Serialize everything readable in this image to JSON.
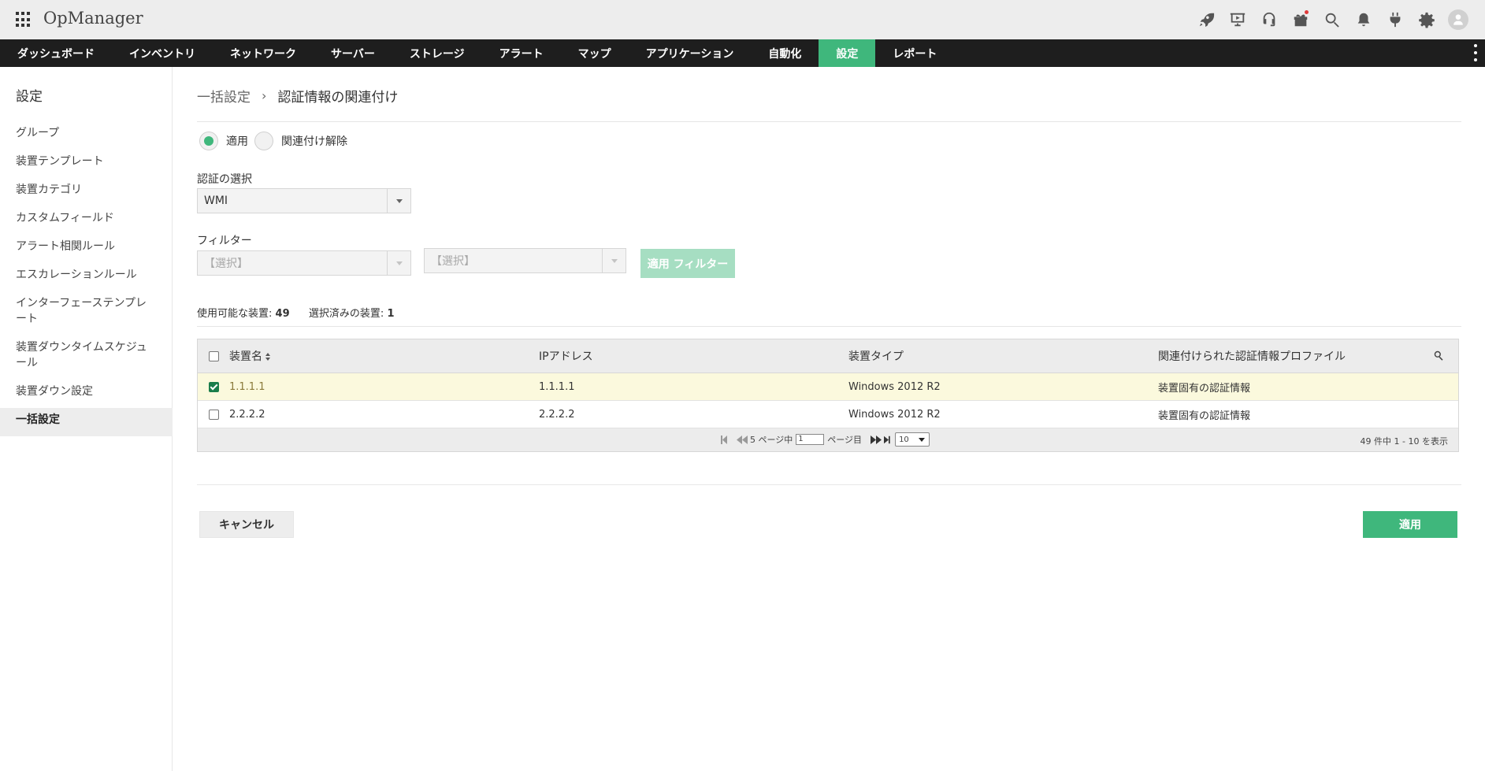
{
  "app": {
    "title": "OpManager"
  },
  "top_icons": [
    {
      "name": "rocket-icon"
    },
    {
      "name": "presentation-icon"
    },
    {
      "name": "headset-icon"
    },
    {
      "name": "gift-icon"
    },
    {
      "name": "search-icon"
    },
    {
      "name": "bell-icon"
    },
    {
      "name": "plug-icon"
    },
    {
      "name": "gear-icon"
    },
    {
      "name": "user-avatar-icon"
    }
  ],
  "nav": {
    "items": [
      {
        "label": "ダッシュボード"
      },
      {
        "label": "インベントリ"
      },
      {
        "label": "ネットワーク"
      },
      {
        "label": "サーバー"
      },
      {
        "label": "ストレージ"
      },
      {
        "label": "アラート"
      },
      {
        "label": "マップ"
      },
      {
        "label": "アプリケーション"
      },
      {
        "label": "自動化"
      },
      {
        "label": "設定"
      },
      {
        "label": "レポート"
      }
    ],
    "active": "設定",
    "accent_color": "#3fb77c"
  },
  "sidebar": {
    "title": "設定",
    "items": [
      {
        "label": "グループ"
      },
      {
        "label": "装置テンプレート"
      },
      {
        "label": "装置カテゴリ"
      },
      {
        "label": "カスタムフィールド"
      },
      {
        "label": "アラート相関ルール"
      },
      {
        "label": "エスカレーションルール"
      },
      {
        "label": "インターフェーステンプレート"
      },
      {
        "label": "装置ダウンタイムスケジュール"
      },
      {
        "label": "装置ダウン設定"
      },
      {
        "label": "一括設定"
      }
    ],
    "active": "一括設定"
  },
  "breadcrumb": {
    "parent": "一括設定",
    "separator": "›",
    "current": "認証情報の関連付け"
  },
  "mode": {
    "options": [
      {
        "label": "適用",
        "checked": true
      },
      {
        "label": "関連付け解除",
        "checked": false
      }
    ]
  },
  "credential": {
    "label": "認証の選択",
    "value": "WMI"
  },
  "filter": {
    "label": "フィルター",
    "primary_value": "【選択】",
    "secondary_value": "【選択】",
    "apply_label": "適用 フィルター"
  },
  "counts": {
    "available_label": "使用可能な装置:",
    "available_value": "49",
    "selected_label": "選択済みの装置:",
    "selected_value": "1"
  },
  "table": {
    "columns": [
      "装置名",
      "IPアドレス",
      "装置タイプ",
      "関連付けられた認証情報プロファイル"
    ],
    "rows": [
      {
        "name": "1.1.1.1",
        "ip": "1.1.1.1",
        "type": "Windows 2012 R2",
        "profile": "装置固有の認証情報",
        "checked": true
      },
      {
        "name": "2.2.2.2",
        "ip": "2.2.2.2",
        "type": "Windows 2012 R2",
        "profile": "装置固有の認証情報",
        "checked": false
      }
    ]
  },
  "pager": {
    "pages_prefix": "5 ページ中",
    "current_page": "1",
    "pages_suffix": "ページ目",
    "page_size": "10",
    "info": "49 件中 1 - 10 を表示"
  },
  "actions": {
    "cancel_label": "キャンセル",
    "apply_label": "適用"
  }
}
